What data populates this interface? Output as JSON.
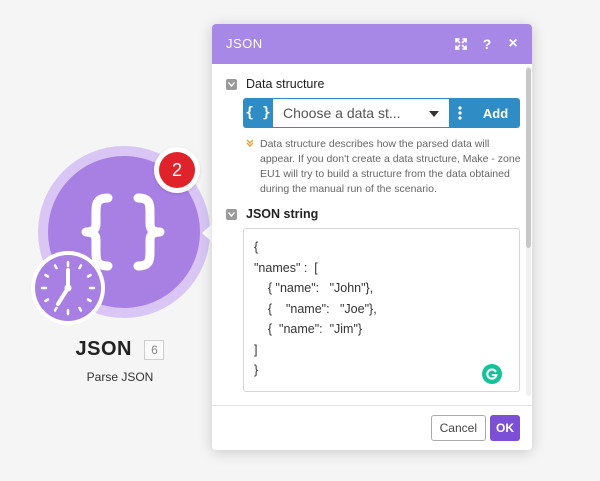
{
  "module": {
    "title": "JSON",
    "number": "6",
    "subtitle": "Parse JSON",
    "badge_count": "2",
    "icons": [
      "braces-icon",
      "clock-icon"
    ]
  },
  "dialog": {
    "title": "JSON",
    "header_icons": [
      "expand-icon",
      "help-icon",
      "close-icon"
    ],
    "help_glyph": "?",
    "close_glyph": "×",
    "data_structure": {
      "label": "Data structure",
      "left_glyph": "{ }",
      "placeholder": "Choose a data st...",
      "add_label": "Add",
      "help_text": "Data structure describes how the parsed data will appear. If you don't create a data structure, Make - zone EU1 will try to build a structure from the data obtained during the manual run of the scenario."
    },
    "json_string": {
      "label": "JSON string",
      "value": "{\n\"names\" :  [\n    { \"name\":   \"John\"},\n    {    \"name\":   \"Joe\"},\n    {  \"name\":  \"Jim\"}\n]\n}"
    },
    "footer": {
      "cancel_label": "Cancel",
      "ok_label": "OK"
    }
  },
  "colors": {
    "header": "#a888e6",
    "module": "#a880e4",
    "accent_blue": "#2f8cc4",
    "ok_button": "#7b4fd6",
    "badge": "#e0222b"
  }
}
